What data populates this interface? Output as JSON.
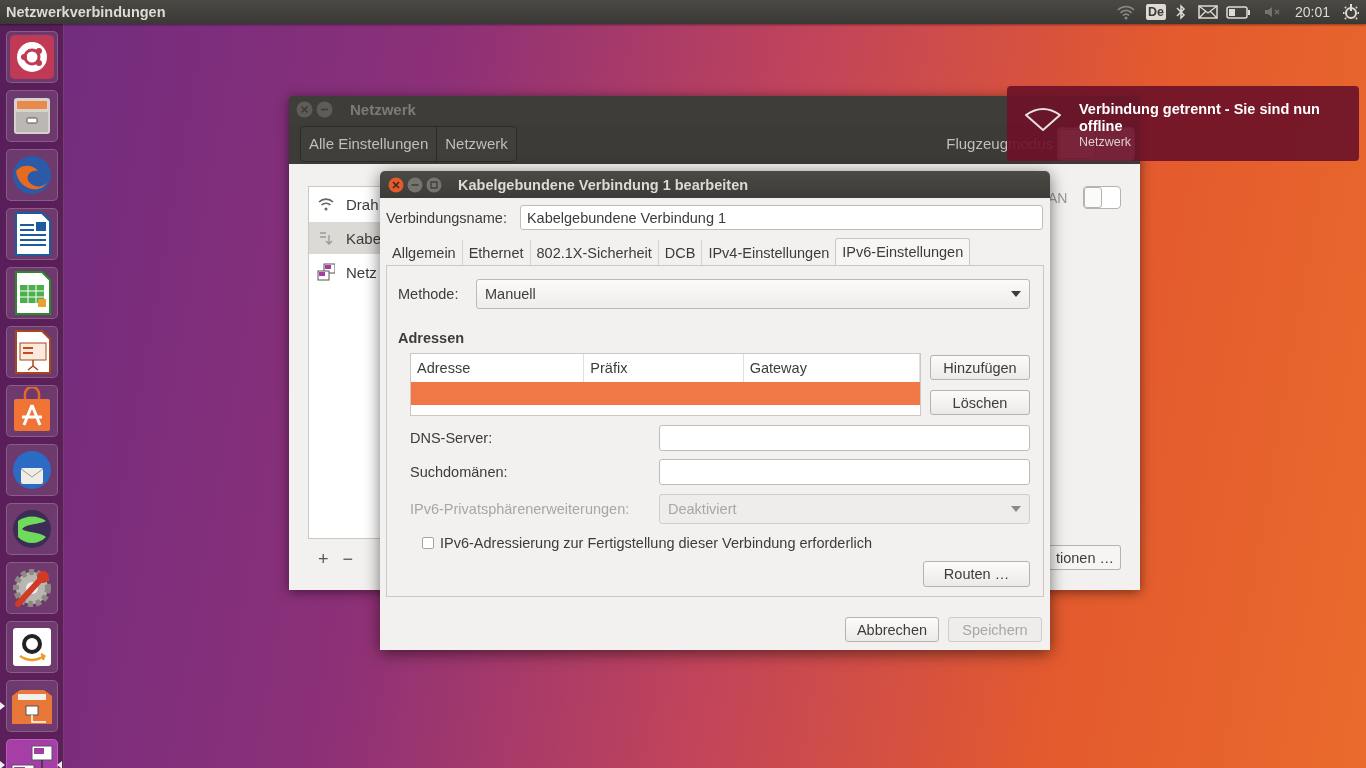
{
  "top_panel": {
    "title": "Netzwerkverbindungen",
    "keyboard_layout": "De",
    "clock": "20:01"
  },
  "launcher": {
    "items": [
      {
        "kind": "ubuntu",
        "running": false,
        "focused": false
      },
      {
        "kind": "files",
        "running": false,
        "focused": false
      },
      {
        "kind": "firefox",
        "running": false,
        "focused": false
      },
      {
        "kind": "writer",
        "running": false,
        "focused": false
      },
      {
        "kind": "calc",
        "running": false,
        "focused": false
      },
      {
        "kind": "impress",
        "running": false,
        "focused": false
      },
      {
        "kind": "software",
        "running": false,
        "focused": false
      },
      {
        "kind": "thunderbird",
        "running": false,
        "focused": false
      },
      {
        "kind": "globe",
        "running": false,
        "focused": false
      },
      {
        "kind": "settings",
        "running": false,
        "focused": false
      },
      {
        "kind": "amazon",
        "running": false,
        "focused": false
      },
      {
        "kind": "network-folder",
        "running": true,
        "focused": false
      },
      {
        "kind": "network-connections",
        "running": true,
        "focused": true
      }
    ]
  },
  "network_window": {
    "title": "Netzwerk",
    "breadcrumbs": [
      {
        "label": "Alle Einstellungen"
      },
      {
        "label": "Netzwerk"
      }
    ],
    "airplane_mode": {
      "label": "Flugzeugmodus",
      "on": false
    },
    "devices": [
      {
        "kind": "wifi",
        "label": "Drah",
        "selected": false
      },
      {
        "kind": "wired",
        "label": "Kabe",
        "selected": true
      },
      {
        "kind": "proxy",
        "label": "Netz",
        "selected": false
      }
    ],
    "device_switch": {
      "label": "AN",
      "on": false
    },
    "options_button": "tionen …",
    "add_button": "+",
    "remove_button": "−"
  },
  "dialog": {
    "title": "Kabelgebundene Verbindung 1 bearbeiten",
    "connection_name_label": "Verbindungsname:",
    "connection_name": "Kabelgebundene Verbindung 1",
    "tabs": [
      {
        "label": "Allgemein",
        "selected": false
      },
      {
        "label": "Ethernet",
        "selected": false
      },
      {
        "label": "802.1X-Sicherheit",
        "selected": false
      },
      {
        "label": "DCB",
        "selected": false
      },
      {
        "label": "IPv4-Einstellungen",
        "selected": false
      },
      {
        "label": "IPv6-Einstellungen",
        "selected": true
      }
    ],
    "method": {
      "label": "Methode:",
      "value": "Manuell"
    },
    "addresses": {
      "heading": "Adressen",
      "columns": [
        "Adresse",
        "Präfix",
        "Gateway"
      ],
      "rows": [
        {
          "selected": true
        }
      ],
      "add_button": "Hinzufügen",
      "delete_button": "Löschen"
    },
    "dns_label": "DNS-Server:",
    "search_domains_label": "Suchdomänen:",
    "privacy": {
      "label": "IPv6-Privatsphärenerweiterungen:",
      "value": "Deaktiviert",
      "disabled": true
    },
    "require_ipv6": {
      "label": "IPv6-Adressierung zur Fertigstellung dieser Verbindung erforderlich",
      "checked": false
    },
    "routes_button": "Routen …",
    "cancel_button": {
      "label": "Abbrechen",
      "disabled": false
    },
    "save_button": {
      "label": "Speichern",
      "disabled": true
    }
  },
  "notification": {
    "title": "Verbindung getrennt - Sie sind nun offline",
    "source": "Netzwerk"
  }
}
